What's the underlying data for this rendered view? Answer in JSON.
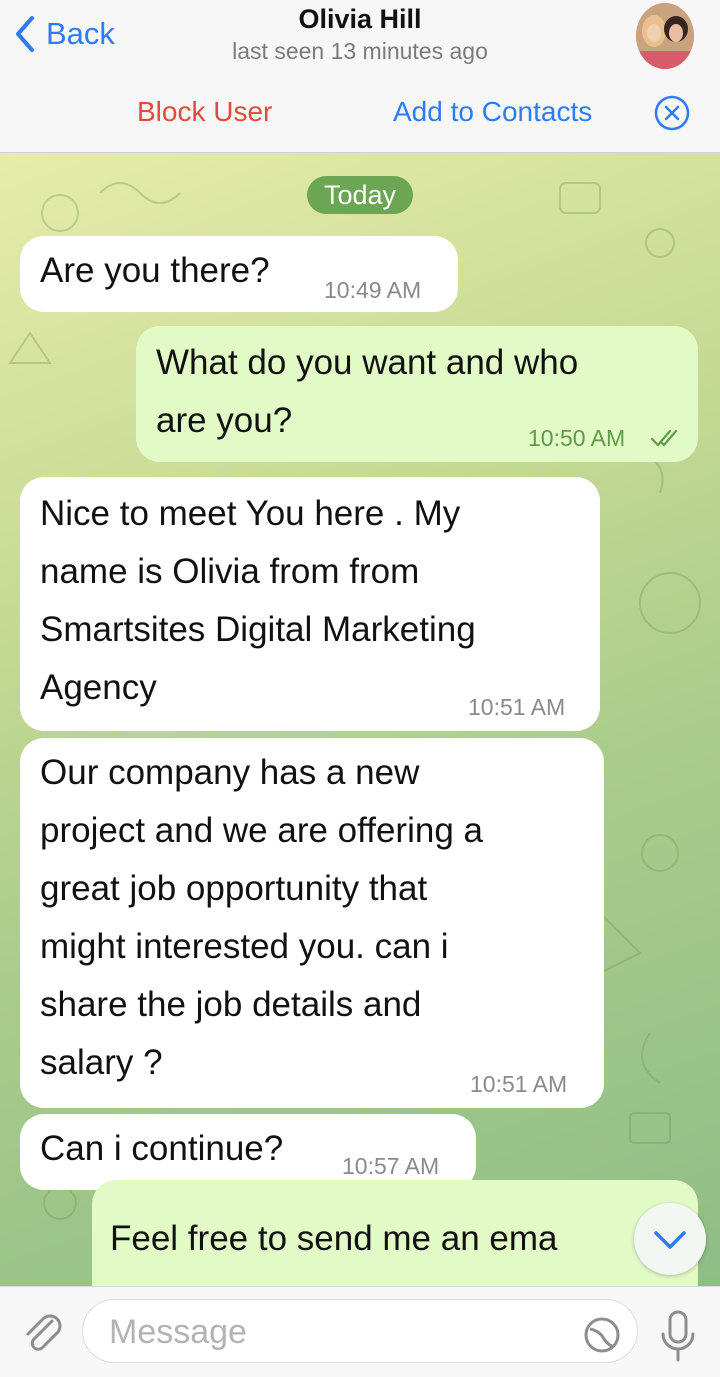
{
  "header": {
    "back_label": "Back",
    "contact_name": "Olivia Hill",
    "last_seen": "last seen 13 minutes ago"
  },
  "actions": {
    "block_user": "Block User",
    "add_to_contacts": "Add to Contacts"
  },
  "chat": {
    "date_label": "Today",
    "messages": [
      {
        "dir": "in",
        "lines": [
          "Are you there?"
        ],
        "time": "10:49 AM"
      },
      {
        "dir": "out",
        "lines": [
          "What do you want and who",
          "are you?"
        ],
        "time": "10:50 AM",
        "read": true
      },
      {
        "dir": "in",
        "lines": [
          "Nice to meet You here . My",
          "name is Olivia  from  from",
          "Smartsites Digital Marketing",
          "Agency"
        ],
        "time": "10:51 AM"
      },
      {
        "dir": "in",
        "lines": [
          "Our company has a new",
          "project and we are offering a",
          "great job opportunity that",
          "might interested you. can i",
          "share the job details and",
          "salary ?"
        ],
        "time": "10:51 AM"
      },
      {
        "dir": "in",
        "lines": [
          "Can i continue?"
        ],
        "time": "10:57 AM"
      },
      {
        "dir": "out",
        "lines": [
          "Feel free to send me an ema"
        ],
        "time": ""
      }
    ]
  },
  "input": {
    "placeholder": "Message"
  },
  "colors": {
    "accent": "#2f7bf6",
    "danger": "#e24b3b",
    "incoming_bubble": "#ffffff",
    "outgoing_bubble": "#e2fbc6",
    "date_pill": "#6aa653"
  }
}
